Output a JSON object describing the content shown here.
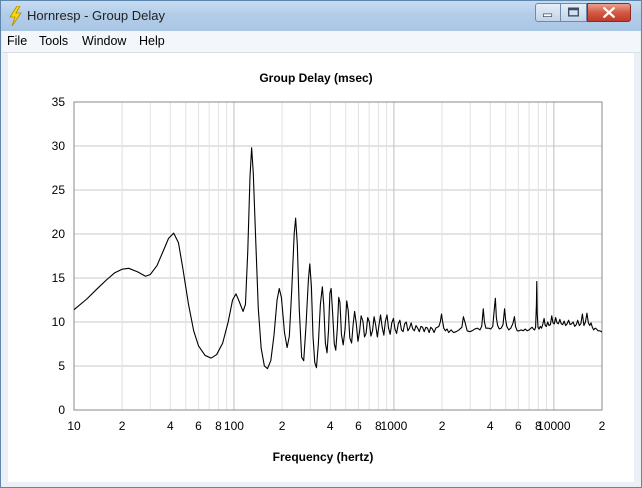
{
  "window": {
    "title": "Hornresp - Group Delay",
    "app_icon": "lightning-bolt-icon",
    "controls": {
      "minimize_icon": "minimize-icon",
      "maximize_icon": "maximize-icon",
      "close_icon": "close-icon"
    }
  },
  "menu": {
    "items": [
      "File",
      "Tools",
      "Window",
      "Help"
    ]
  },
  "colors": {
    "titlebar": "#b3cde8",
    "plot_background": "#ffffff",
    "grid": "#c8c8c8",
    "trace": "#000000",
    "close_button": "#c0392b"
  },
  "chart_data": {
    "type": "line",
    "title": "Group Delay (msec)",
    "xlabel": "Frequency (hertz)",
    "ylabel": "",
    "x_scale": "log",
    "xlim": [
      10,
      20000
    ],
    "ylim": [
      0,
      35
    ],
    "grid": true,
    "legend": "none",
    "y_ticks": [
      "0",
      "5",
      "10",
      "15",
      "20",
      "25",
      "30",
      "35"
    ],
    "x_ticks": [
      {
        "value": 10,
        "label": "10"
      },
      {
        "value": 20,
        "label": "2"
      },
      {
        "value": 40,
        "label": "4"
      },
      {
        "value": 60,
        "label": "6"
      },
      {
        "value": 80,
        "label": "8"
      },
      {
        "value": 100,
        "label": "100"
      },
      {
        "value": 200,
        "label": "2"
      },
      {
        "value": 400,
        "label": "4"
      },
      {
        "value": 600,
        "label": "6"
      },
      {
        "value": 800,
        "label": "8"
      },
      {
        "value": 1000,
        "label": "1000"
      },
      {
        "value": 2000,
        "label": "2"
      },
      {
        "value": 4000,
        "label": "4"
      },
      {
        "value": 6000,
        "label": "6"
      },
      {
        "value": 8000,
        "label": "8"
      },
      {
        "value": 10000,
        "label": "10000"
      },
      {
        "value": 20000,
        "label": "2"
      }
    ],
    "series": [
      {
        "points": [
          [
            10,
            11.4
          ],
          [
            12,
            12.6
          ],
          [
            14,
            13.8
          ],
          [
            16,
            14.8
          ],
          [
            18,
            15.6
          ],
          [
            20,
            16.0
          ],
          [
            22,
            16.1
          ],
          [
            25,
            15.7
          ],
          [
            28,
            15.2
          ],
          [
            30,
            15.4
          ],
          [
            33,
            16.4
          ],
          [
            36,
            18.0
          ],
          [
            39,
            19.5
          ],
          [
            42,
            20.1
          ],
          [
            45,
            19.0
          ],
          [
            48,
            16.0
          ],
          [
            52,
            12.0
          ],
          [
            56,
            9.0
          ],
          [
            60,
            7.3
          ],
          [
            66,
            6.2
          ],
          [
            72,
            5.9
          ],
          [
            78,
            6.3
          ],
          [
            85,
            7.6
          ],
          [
            92,
            10.0
          ],
          [
            98,
            12.5
          ],
          [
            103,
            13.2
          ],
          [
            108,
            12.3
          ],
          [
            114,
            11.2
          ],
          [
            118,
            12.0
          ],
          [
            122,
            18.0
          ],
          [
            126,
            26.5
          ],
          [
            129,
            29.8
          ],
          [
            132,
            27.0
          ],
          [
            137,
            19.0
          ],
          [
            142,
            11.5
          ],
          [
            148,
            7.0
          ],
          [
            155,
            5.0
          ],
          [
            162,
            4.7
          ],
          [
            170,
            5.6
          ],
          [
            178,
            8.5
          ],
          [
            186,
            12.5
          ],
          [
            192,
            13.8
          ],
          [
            198,
            12.8
          ],
          [
            207,
            8.8
          ],
          [
            215,
            7.1
          ],
          [
            222,
            8.4
          ],
          [
            230,
            13.8
          ],
          [
            238,
            20.0
          ],
          [
            243,
            21.8
          ],
          [
            249,
            18.8
          ],
          [
            256,
            11.5
          ],
          [
            265,
            6.0
          ],
          [
            273,
            5.6
          ],
          [
            282,
            9.5
          ],
          [
            292,
            14.8
          ],
          [
            298,
            16.6
          ],
          [
            305,
            14.0
          ],
          [
            312,
            8.4
          ],
          [
            320,
            5.4
          ],
          [
            328,
            4.8
          ],
          [
            337,
            7.5
          ],
          [
            347,
            12.0
          ],
          [
            357,
            14.0
          ],
          [
            364,
            12.0
          ],
          [
            373,
            7.6
          ],
          [
            382,
            6.5
          ],
          [
            390,
            9.0
          ],
          [
            398,
            13.3
          ],
          [
            405,
            13.8
          ],
          [
            414,
            11.0
          ],
          [
            424,
            7.5
          ],
          [
            433,
            6.8
          ],
          [
            443,
            9.3
          ],
          [
            452,
            12.8
          ],
          [
            460,
            12.2
          ],
          [
            470,
            8.6
          ],
          [
            482,
            7.4
          ],
          [
            495,
            9.2
          ],
          [
            507,
            12.4
          ],
          [
            518,
            11.3
          ],
          [
            530,
            8.2
          ],
          [
            544,
            7.6
          ],
          [
            556,
            9.7
          ],
          [
            568,
            11.2
          ],
          [
            582,
            9.8
          ],
          [
            596,
            7.8
          ],
          [
            610,
            8.9
          ],
          [
            624,
            10.7
          ],
          [
            640,
            10.1
          ],
          [
            655,
            8.3
          ],
          [
            670,
            8.7
          ],
          [
            686,
            10.5
          ],
          [
            702,
            10.0
          ],
          [
            718,
            8.4
          ],
          [
            735,
            9.0
          ],
          [
            752,
            10.6
          ],
          [
            770,
            9.6
          ],
          [
            788,
            8.3
          ],
          [
            806,
            9.6
          ],
          [
            825,
            10.8
          ],
          [
            845,
            9.4
          ],
          [
            865,
            8.5
          ],
          [
            885,
            10.1
          ],
          [
            905,
            10.8
          ],
          [
            926,
            9.3
          ],
          [
            948,
            8.6
          ],
          [
            970,
            9.9
          ],
          [
            993,
            10.4
          ],
          [
            1016,
            9.2
          ],
          [
            1040,
            8.7
          ],
          [
            1065,
            9.8
          ],
          [
            1090,
            10.2
          ],
          [
            1115,
            9.1
          ],
          [
            1141,
            8.9
          ],
          [
            1168,
            9.8
          ],
          [
            1195,
            10.0
          ],
          [
            1223,
            9.0
          ],
          [
            1252,
            9.3
          ],
          [
            1282,
            9.9
          ],
          [
            1312,
            9.2
          ],
          [
            1343,
            9.0
          ],
          [
            1375,
            9.6
          ],
          [
            1408,
            9.3
          ],
          [
            1441,
            8.9
          ],
          [
            1476,
            9.5
          ],
          [
            1511,
            9.4
          ],
          [
            1547,
            8.9
          ],
          [
            1584,
            9.4
          ],
          [
            1622,
            9.3
          ],
          [
            1661,
            8.8
          ],
          [
            1700,
            9.4
          ],
          [
            1741,
            9.2
          ],
          [
            1783,
            8.8
          ],
          [
            1826,
            9.3
          ],
          [
            1870,
            9.4
          ],
          [
            1910,
            9.5
          ],
          [
            1950,
            10.0
          ],
          [
            1985,
            10.9
          ],
          [
            2010,
            10.2
          ],
          [
            2050,
            9.3
          ],
          [
            2100,
            9.0
          ],
          [
            2150,
            9.2
          ],
          [
            2200,
            8.8
          ],
          [
            2280,
            9.1
          ],
          [
            2360,
            8.8
          ],
          [
            2450,
            8.9
          ],
          [
            2550,
            9.1
          ],
          [
            2660,
            9.4
          ],
          [
            2720,
            10.6
          ],
          [
            2790,
            9.9
          ],
          [
            2870,
            9.0
          ],
          [
            2980,
            8.9
          ],
          [
            3080,
            9.0
          ],
          [
            3200,
            9.2
          ],
          [
            3330,
            9.3
          ],
          [
            3450,
            9.1
          ],
          [
            3540,
            9.5
          ],
          [
            3620,
            11.5
          ],
          [
            3680,
            10.0
          ],
          [
            3760,
            9.3
          ],
          [
            3900,
            9.3
          ],
          [
            4030,
            9.2
          ],
          [
            4150,
            9.5
          ],
          [
            4260,
            11.8
          ],
          [
            4310,
            12.7
          ],
          [
            4370,
            10.5
          ],
          [
            4450,
            9.6
          ],
          [
            4560,
            9.2
          ],
          [
            4690,
            9.3
          ],
          [
            4810,
            9.7
          ],
          [
            4920,
            11.5
          ],
          [
            4990,
            10.3
          ],
          [
            5080,
            9.5
          ],
          [
            5220,
            9.1
          ],
          [
            5380,
            9.3
          ],
          [
            5540,
            9.8
          ],
          [
            5670,
            10.6
          ],
          [
            5760,
            9.5
          ],
          [
            5900,
            9.0
          ],
          [
            6080,
            9.0
          ],
          [
            6250,
            9.1
          ],
          [
            6430,
            9.0
          ],
          [
            6620,
            9.2
          ],
          [
            6820,
            9.0
          ],
          [
            7010,
            9.1
          ],
          [
            7180,
            9.3
          ],
          [
            7320,
            9.4
          ],
          [
            7450,
            9.2
          ],
          [
            7580,
            9.1
          ],
          [
            7690,
            9.4
          ],
          [
            7780,
            12.0
          ],
          [
            7820,
            14.6
          ],
          [
            7870,
            11.0
          ],
          [
            7960,
            9.4
          ],
          [
            8080,
            9.2
          ],
          [
            8230,
            9.5
          ],
          [
            8380,
            9.3
          ],
          [
            8540,
            9.8
          ],
          [
            8690,
            10.4
          ],
          [
            8830,
            9.6
          ],
          [
            8980,
            9.5
          ],
          [
            9150,
            10.0
          ],
          [
            9330,
            9.6
          ],
          [
            9520,
            9.7
          ],
          [
            9700,
            10.7
          ],
          [
            9880,
            9.9
          ],
          [
            10070,
            9.8
          ],
          [
            10260,
            10.5
          ],
          [
            10470,
            9.9
          ],
          [
            10680,
            9.8
          ],
          [
            10900,
            10.3
          ],
          [
            11120,
            9.8
          ],
          [
            11350,
            9.7
          ],
          [
            11600,
            10.1
          ],
          [
            11850,
            9.6
          ],
          [
            12110,
            9.8
          ],
          [
            12370,
            10.2
          ],
          [
            12640,
            9.7
          ],
          [
            12920,
            9.8
          ],
          [
            13200,
            10.0
          ],
          [
            13500,
            9.5
          ],
          [
            13800,
            9.7
          ],
          [
            14100,
            10.2
          ],
          [
            14420,
            9.6
          ],
          [
            14750,
            9.8
          ],
          [
            15080,
            10.9
          ],
          [
            15420,
            9.6
          ],
          [
            15760,
            10.0
          ],
          [
            16100,
            11.0
          ],
          [
            16440,
            9.9
          ],
          [
            16760,
            9.6
          ],
          [
            17080,
            9.9
          ],
          [
            17400,
            9.4
          ],
          [
            17750,
            9.1
          ],
          [
            18100,
            9.3
          ],
          [
            18500,
            9.2
          ],
          [
            18900,
            9.0
          ],
          [
            19400,
            9.0
          ],
          [
            19800,
            8.9
          ],
          [
            20000,
            8.9
          ]
        ]
      }
    ]
  }
}
